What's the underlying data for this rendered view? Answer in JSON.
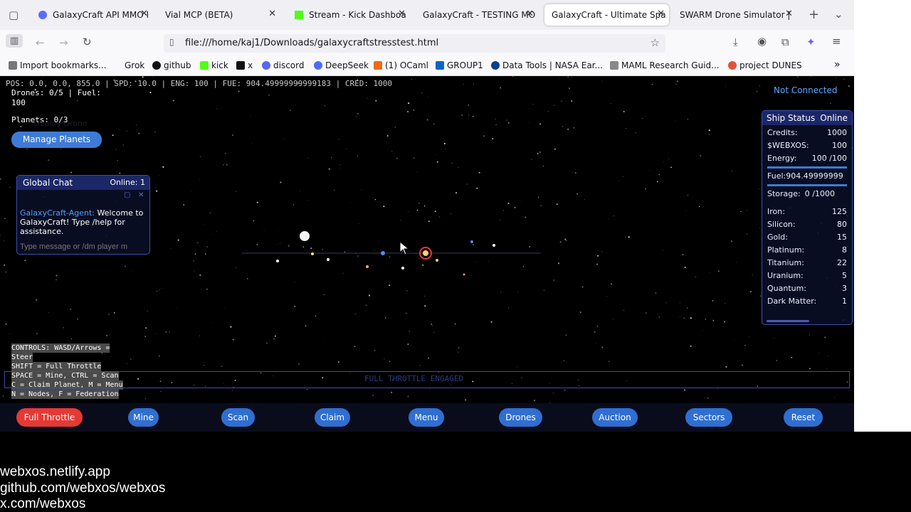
{
  "tabs": [
    {
      "title": "GalaxyCraft API MMO I",
      "fav": "#5b6cff"
    },
    {
      "title": "Vial MCP (BETA)",
      "fav": ""
    },
    {
      "title": "Stream - Kick Dashboa",
      "fav": "#53fc18"
    },
    {
      "title": "GalaxyCraft - TESTING MO",
      "fav": ""
    },
    {
      "title": "GalaxyCraft - Ultimate Spa",
      "fav": ""
    },
    {
      "title": "SWARM Drone Simulator |",
      "fav": ""
    }
  ],
  "url": "file:///home/kaj1/Downloads/galaxycraftstresstest.html",
  "bookmarks": [
    {
      "label": "Import bookmarks...",
      "color": "#777"
    },
    {
      "label": "Grok",
      "color": ""
    },
    {
      "label": "github",
      "color": "#111"
    },
    {
      "label": "kick",
      "color": "#53fc18"
    },
    {
      "label": "x",
      "color": "#111"
    },
    {
      "label": "discord",
      "color": "#5865f2"
    },
    {
      "label": "DeepSeek",
      "color": "#4d6bfe"
    },
    {
      "label": "(1) OCaml",
      "color": "#ee6a1a"
    },
    {
      "label": "GROUP1",
      "color": "#0a66c2"
    },
    {
      "label": "Data Tools | NASA Ear...",
      "color": "#0b3d91"
    },
    {
      "label": "MAML Research Guid...",
      "color": "#888"
    },
    {
      "label": "project DUNES",
      "color": "#e0523b"
    }
  ],
  "hud": {
    "top_line": "POS: 0.0, 0.0, 855.0 | SPD: 10.0 | ENG: 100 | FUE: 904.49999999999183 | CRED: 1000",
    "drones": "Drones: 0/5 | Fuel:",
    "fuel_line": "100",
    "planets": "Planets: 0/3",
    "hidden_btn": "Deploy Drone",
    "manage_planets": "Manage Planets",
    "connection": "Not Connected"
  },
  "chat": {
    "title": "Global Chat",
    "online": "Online: 1",
    "sender": "GalaxyCraft-Agent:",
    "message": "Welcome to GalaxyCraft! Type /help for assistance.",
    "placeholder": "Type message or /dm player m"
  },
  "ship": {
    "title": "Ship Status",
    "status": "Online",
    "credits_label": "Credits:",
    "credits": "1000",
    "webxos_label": "$WEBXOS:",
    "webxos": "100",
    "energy_label": "Energy:",
    "energy": "100 /100",
    "fuel_text": "Fuel:904.49999999",
    "storage_label": "Storage:",
    "storage": "0 /1000",
    "energy_level": 1.0,
    "fuel_level": 1.0,
    "resources": [
      {
        "name": "Iron:",
        "value": "125"
      },
      {
        "name": "Silicon:",
        "value": "80"
      },
      {
        "name": "Gold:",
        "value": "15"
      },
      {
        "name": "Platinum:",
        "value": "8"
      },
      {
        "name": "Titanium:",
        "value": "22"
      },
      {
        "name": "Uranium:",
        "value": "5"
      },
      {
        "name": "Quantum:",
        "value": "3"
      },
      {
        "name": "Dark Matter:",
        "value": "1"
      }
    ]
  },
  "controls": [
    "CONTROLS: WASD/Arrows =",
    "Steer",
    "SHIFT = Full Throttle",
    "SPACE = Mine, CTRL = Scan",
    "C = Claim Planet, M = Menu",
    "N = Nodes, F = Federation"
  ],
  "notice": "FULL THROTTLE ENGAGED",
  "buttons": [
    "Full Throttle",
    "Mine",
    "Scan",
    "Claim",
    "Menu",
    "Drones",
    "Auction",
    "Sectors",
    "Reset"
  ],
  "footer": [
    "webxos.netlify.app",
    "github.com/webxos/webxos",
    "x.com/webxos"
  ],
  "colors": {
    "accent": "#2f6fd1",
    "danger": "#e53935",
    "panel_border": "#3c4fae",
    "status_text": "#5aa9ff"
  }
}
